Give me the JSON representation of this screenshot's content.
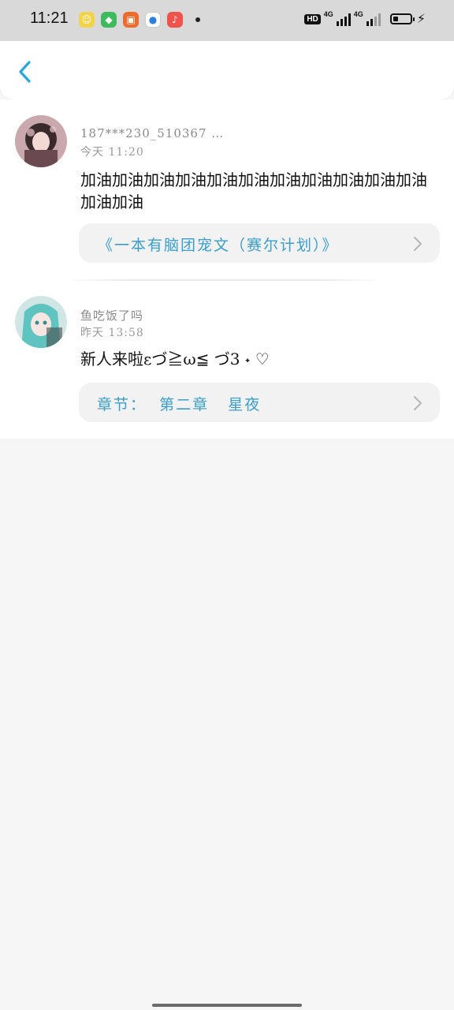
{
  "status_bar": {
    "time": "11:21",
    "hd_label": "HD",
    "network_1": "4G",
    "network_2": "4G"
  },
  "comments": [
    {
      "username": "187***230_510367 …",
      "time": "今天 11:20",
      "content": "加油加油加油加油加油加油加油加油加油加油加油加油加油",
      "reference": "《一本有脑团宠文（赛尔计划）》"
    },
    {
      "username": "鱼吃饭了吗",
      "time": "昨天 13:58",
      "content": "新人来啦εづ≧ω≦ づ3 ˖ ♡",
      "reference": "章节：  第二章   星夜"
    }
  ],
  "colors": {
    "accent": "#3a9ec9",
    "back_arrow": "#2aa6d9"
  }
}
